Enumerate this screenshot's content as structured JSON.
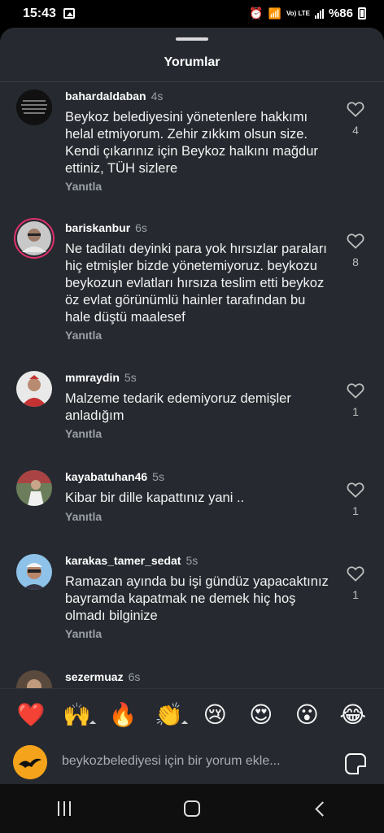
{
  "status_bar": {
    "time": "15:43",
    "volte": "Vo) LTE",
    "battery": "%86"
  },
  "header": {
    "title": "Yorumlar"
  },
  "comments": [
    {
      "username": "bahardaldaban",
      "time": "4s",
      "text": "Beykoz belediyesini yönetenlere hakkımı helal etmiyorum. Zehir zıkkım olsun size. Kendi çıkarınız için Beykoz halkını mağdur ettiniz, TÜH sizlere",
      "reply_label": "Yanıtla",
      "likes": "4"
    },
    {
      "username": "bariskanbur",
      "time": "6s",
      "text": "Ne tadilatı deyinki para yok hırsızlar paraları hiç etmişler bizde yönetemiyoruz. beykozu beykozun evlatları hırsıza teslim etti beykoz öz evlat görünümlü hainler tarafından bu hale düştü maalesef",
      "reply_label": "Yanıtla",
      "likes": "8"
    },
    {
      "username": "mmraydin",
      "time": "5s",
      "text": "Malzeme tedarik edemiyoruz demişler anladığım",
      "reply_label": "Yanıtla",
      "likes": "1"
    },
    {
      "username": "kayabatuhan46",
      "time": "5s",
      "text": "Kibar bir dille kapattınız yani ..",
      "reply_label": "Yanıtla",
      "likes": "1"
    },
    {
      "username": "karakas_tamer_sedat",
      "time": "5s",
      "text": "Ramazan ayında bu işi gündüz yapacaktınız bayramda kapatmak ne demek hiç hoş olmadı bilginize",
      "reply_label": "Yanıtla",
      "likes": "1"
    },
    {
      "username": "sezermuaz",
      "time": "6s"
    }
  ],
  "reactions": [
    "❤️",
    "🙌",
    "🔥",
    "👏",
    "😢",
    "😍",
    "😮",
    "😂"
  ],
  "input": {
    "placeholder": "beykozbelediyesi için bir yorum ekle..."
  },
  "colors": {
    "sheet_background": "#262a30",
    "story_ring": "#e1306c",
    "profile_avatar": "#f5a31a"
  }
}
